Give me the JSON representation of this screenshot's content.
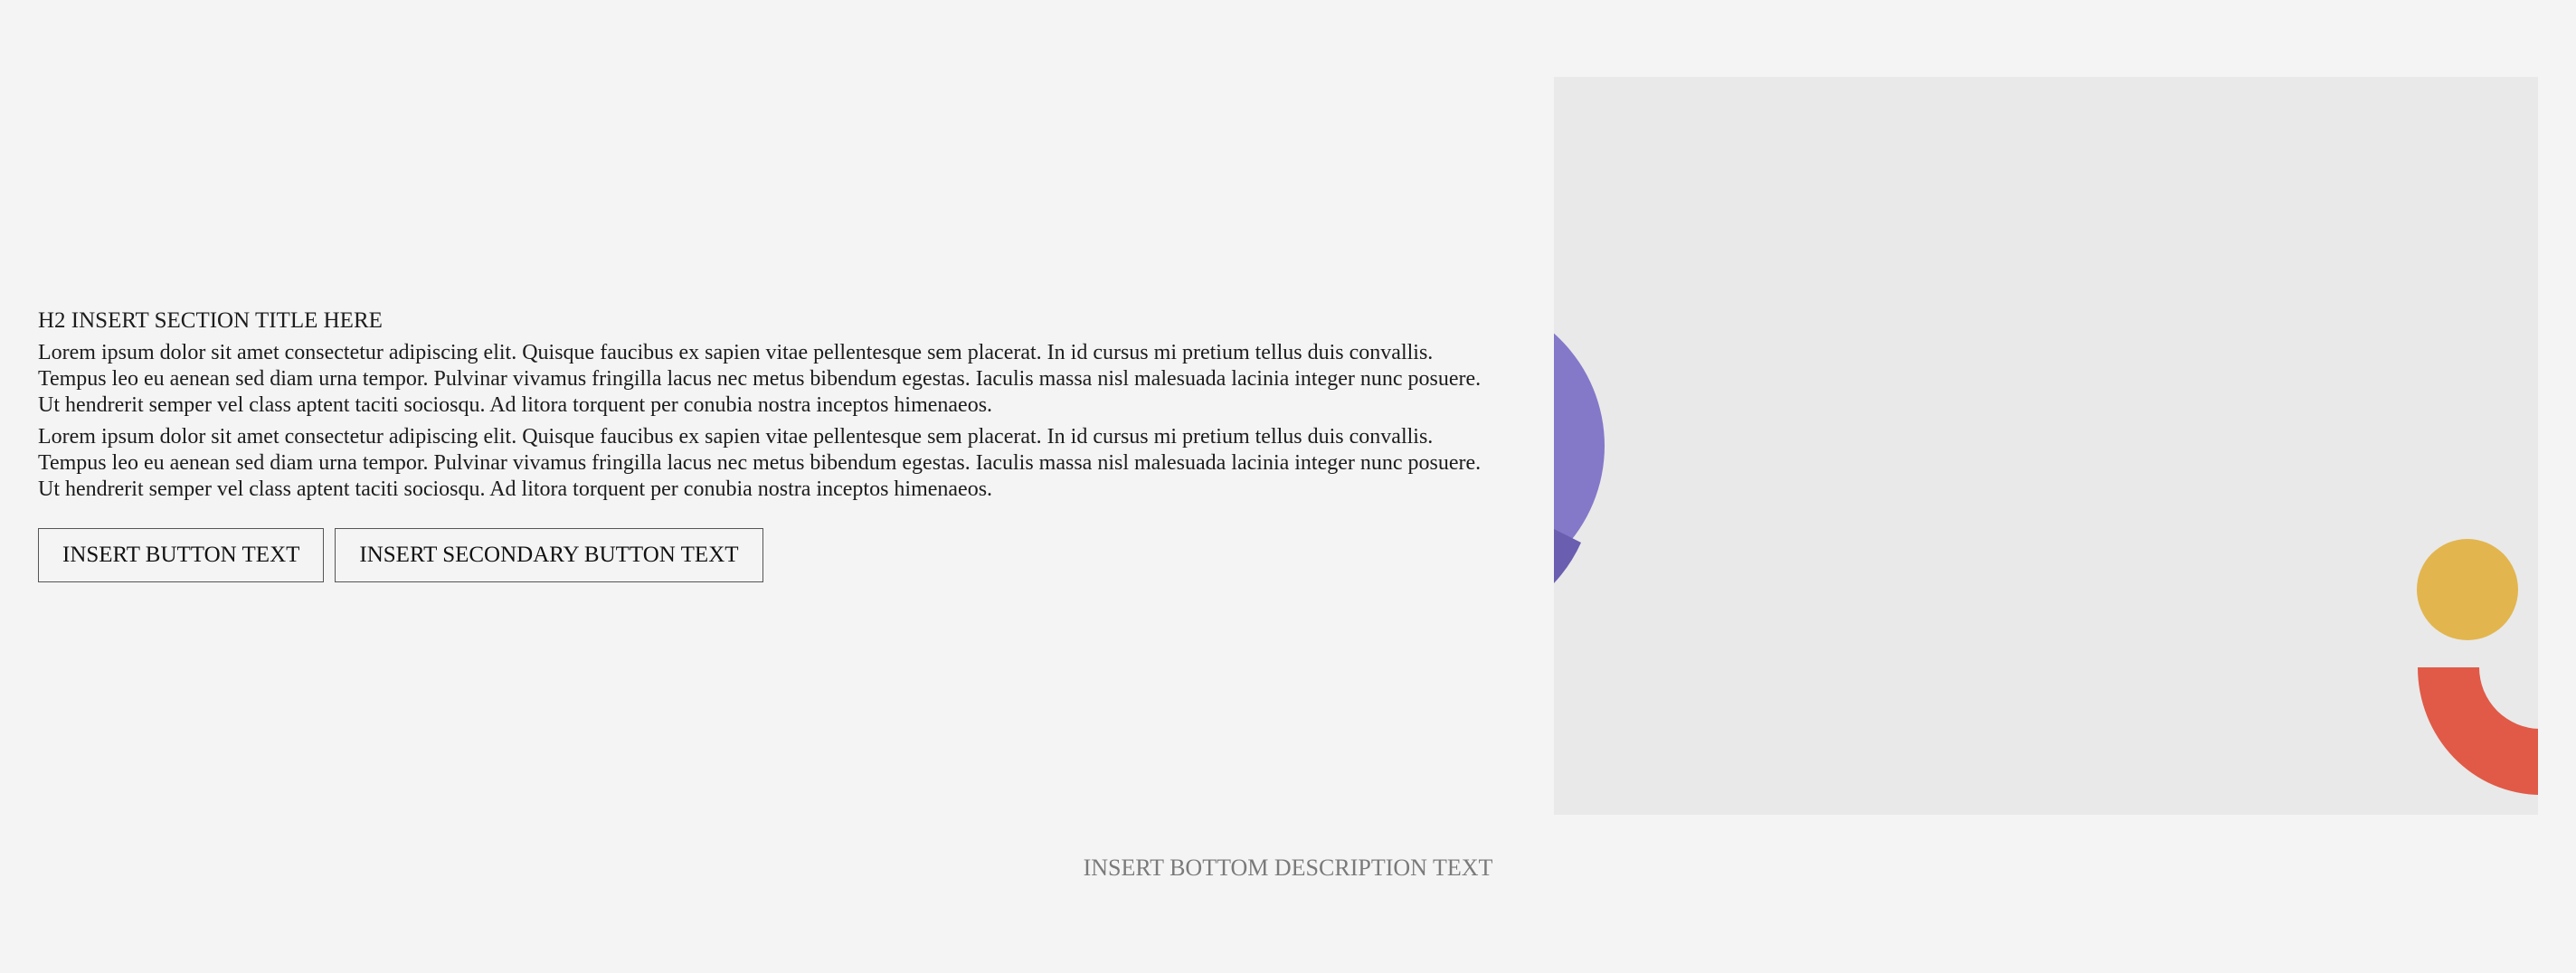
{
  "section": {
    "title": "H2 INSERT SECTION TITLE HERE",
    "paragraphs": [
      "Lorem ipsum dolor sit amet consectetur adipiscing elit. Quisque faucibus ex sapien vitae pellentesque sem placerat. In id cursus mi pretium tellus duis convallis. Tempus leo eu aenean sed diam urna tempor. Pulvinar vivamus fringilla lacus nec metus bibendum egestas. Iaculis massa nisl malesuada lacinia integer nunc posuere. Ut hendrerit semper vel class aptent taciti sociosqu. Ad litora torquent per conubia nostra inceptos himenaeos.",
      "Lorem ipsum dolor sit amet consectetur adipiscing elit. Quisque faucibus ex sapien vitae pellentesque sem placerat. In id cursus mi pretium tellus duis convallis. Tempus leo eu aenean sed diam urna tempor. Pulvinar vivamus fringilla lacus nec metus bibendum egestas. Iaculis massa nisl malesuada lacinia integer nunc posuere. Ut hendrerit semper vel class aptent taciti sociosqu. Ad litora torquent per conubia nostra inceptos himenaeos."
    ],
    "primary_button": "INSERT BUTTON TEXT",
    "secondary_button": "INSERT SECONDARY BUTTON TEXT"
  },
  "image_placeholder": {
    "background": "#e9e9e9",
    "shapes": {
      "purple_circle": "#8478c9",
      "purple_circle_dark": "#6a5eb0",
      "yellow_circle": "#e2b54f",
      "red_arc": "#e05a47"
    }
  },
  "bottom_description": "INSERT BOTTOM DESCRIPTION TEXT"
}
